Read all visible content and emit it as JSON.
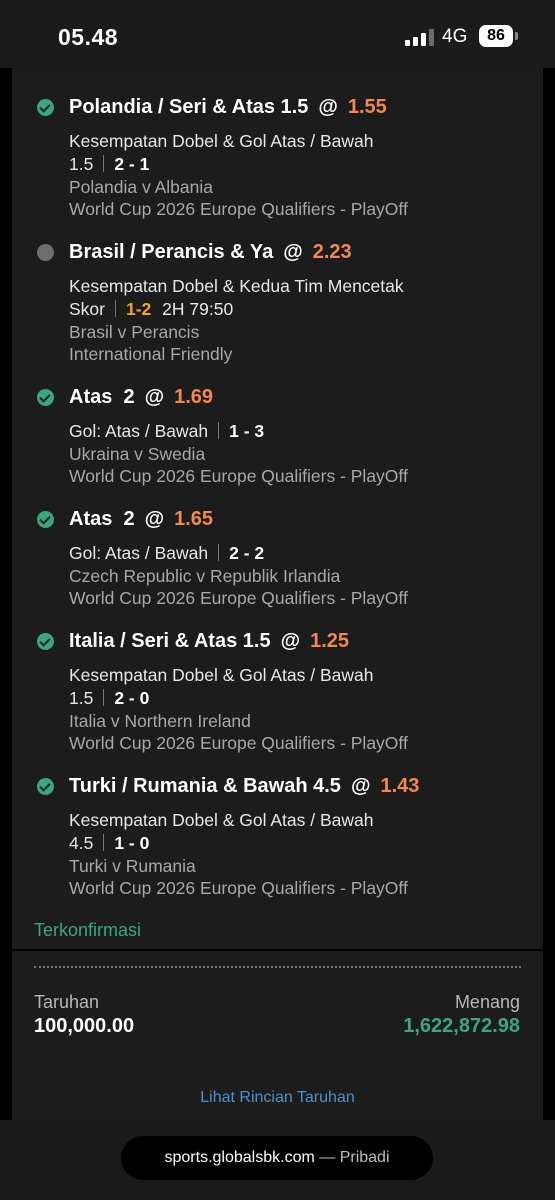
{
  "status_bar": {
    "time": "05.48",
    "network": "4G",
    "battery": "86"
  },
  "bets": [
    {
      "status": "won",
      "selection": "Polandia / Seri & Atas 1.5",
      "at": "@",
      "odds": "1.55",
      "market_line1": "Kesempatan Dobel & Gol Atas / Bawah",
      "market_line2": "1.5",
      "score": "2 - 1",
      "match": "Polandia v Albania",
      "competition": "World Cup 2026 Europe Qualifiers - PlayOff"
    },
    {
      "status": "pending",
      "selection": "Brasil / Perancis & Ya",
      "at": "@",
      "odds": "2.23",
      "market_line1": "Kesempatan Dobel & Kedua Tim Mencetak",
      "market_line2": "Skor",
      "score": "1-2",
      "live_time": "2H 79:50",
      "match": "Brasil v Perancis",
      "competition": "International Friendly"
    },
    {
      "status": "won",
      "selection": "Atas  2",
      "at": "@",
      "odds": "1.69",
      "market_line1": "Gol: Atas / Bawah",
      "score": "1 - 3",
      "match": "Ukraina v Swedia",
      "competition": "World Cup 2026 Europe Qualifiers - PlayOff"
    },
    {
      "status": "won",
      "selection": "Atas  2",
      "at": "@",
      "odds": "1.65",
      "market_line1": "Gol: Atas / Bawah",
      "score": "2 - 2",
      "match": "Czech Republic v Republik Irlandia",
      "competition": "World Cup 2026 Europe Qualifiers - PlayOff"
    },
    {
      "status": "won",
      "selection": "Italia / Seri & Atas 1.5",
      "at": "@",
      "odds": "1.25",
      "market_line1": "Kesempatan Dobel & Gol Atas / Bawah",
      "market_line2": "1.5",
      "score": "2 - 0",
      "match": "Italia v Northern Ireland",
      "competition": "World Cup 2026 Europe Qualifiers - PlayOff"
    },
    {
      "status": "won",
      "selection": "Turki / Rumania & Bawah 4.5",
      "at": "@",
      "odds": "1.43",
      "market_line1": "Kesempatan Dobel & Gol Atas / Bawah",
      "market_line2": "4.5",
      "score": "1 - 0",
      "match": "Turki v Rumania",
      "competition": "World Cup 2026 Europe Qualifiers - PlayOff"
    }
  ],
  "summary": {
    "confirmed": "Terkonfirmasi",
    "stake_label": "Taruhan",
    "stake_value": "100,000.00",
    "win_label": "Menang",
    "win_value": "1,622,872.98",
    "details_link": "Lihat Rincian Taruhan"
  },
  "browser": {
    "url": "sports.globalsbk.com",
    "suffix": " — Pribadi"
  },
  "colors": {
    "odds": "#f5884a",
    "success": "#3aa77e",
    "live_score": "#f5a623",
    "link": "#4f8fcf"
  }
}
